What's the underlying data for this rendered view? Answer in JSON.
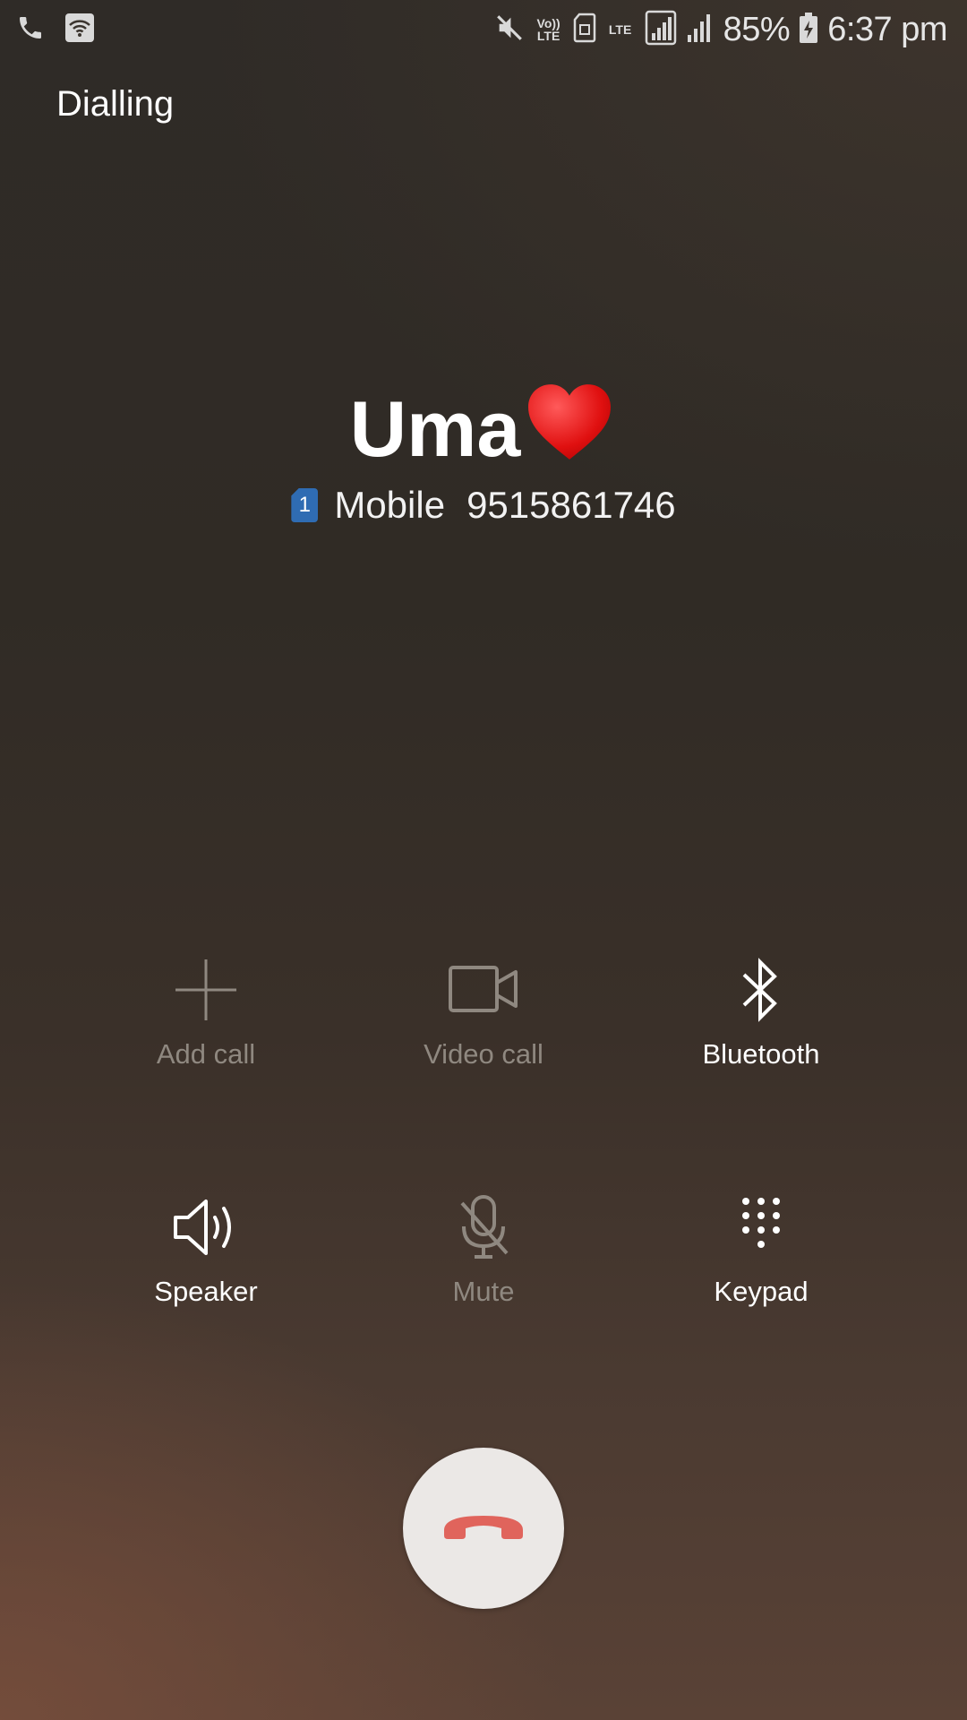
{
  "status_bar": {
    "battery_percent": "85%",
    "time": "6:37 pm",
    "volte_label": "Vo)) LTE",
    "lte_label": "LTE",
    "icons": [
      "call-icon",
      "wifi-icon",
      "mute-icon",
      "volte-icon",
      "sim-card-icon",
      "lte-icon",
      "signal-icon",
      "signal-icon-2",
      "battery-charging-icon"
    ]
  },
  "call": {
    "status": "Dialling",
    "contact_name": "Uma",
    "sim_slot": "1",
    "number_type": "Mobile",
    "number": "9515861746"
  },
  "actions": {
    "add_call": {
      "label": "Add call",
      "enabled": false,
      "icon": "plus-icon"
    },
    "video_call": {
      "label": "Video call",
      "enabled": false,
      "icon": "video-camera-icon"
    },
    "bluetooth": {
      "label": "Bluetooth",
      "enabled": true,
      "icon": "bluetooth-icon"
    },
    "speaker": {
      "label": "Speaker",
      "enabled": true,
      "icon": "speaker-icon"
    },
    "mute": {
      "label": "Mute",
      "enabled": false,
      "icon": "mic-off-icon"
    },
    "keypad": {
      "label": "Keypad",
      "enabled": true,
      "icon": "dialpad-icon"
    }
  },
  "end_call": {
    "icon": "end-call-icon",
    "color": "#e0645c"
  },
  "colors": {
    "enabled_label": "#ffffff",
    "disabled_label": "#8f8880",
    "end_call_bg": "#ebe8e6",
    "sim_badge": "#2f6cb3"
  }
}
